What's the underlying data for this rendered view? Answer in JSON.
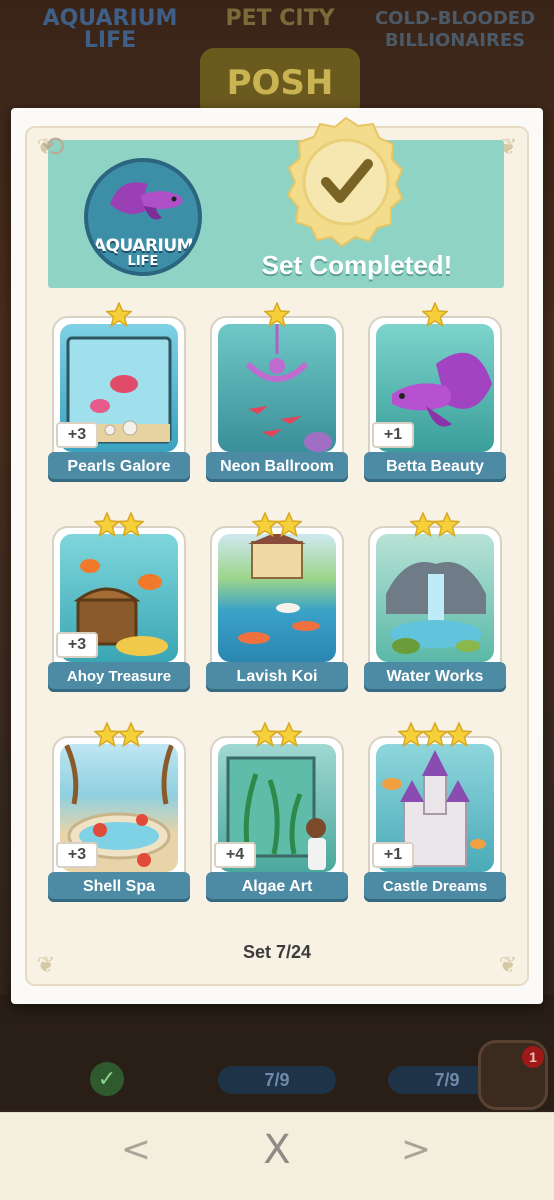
{
  "background": {
    "title": "POSH PETS",
    "sets": [
      {
        "name": "AQUARIUM LIFE",
        "progress": ""
      },
      {
        "name": "PET CITY",
        "progress": "7/9"
      },
      {
        "name": "COLD-BLOODED BILLIONAIRES",
        "progress": "7/9"
      }
    ],
    "notification_count": "1"
  },
  "card": {
    "set_logo": {
      "line1": "AQUARIUM",
      "line2": "LIFE"
    },
    "status_text": "Set Completed!",
    "set_counter": "Set 7/24",
    "stickers": [
      {
        "name": "Pearls Galore",
        "stars": 1,
        "badge": "+3"
      },
      {
        "name": "Neon Ballroom",
        "stars": 1,
        "badge": ""
      },
      {
        "name": "Betta Beauty",
        "stars": 1,
        "badge": "+1"
      },
      {
        "name": "Ahoy Treasure",
        "stars": 2,
        "badge": "+3"
      },
      {
        "name": "Lavish Koi",
        "stars": 2,
        "badge": ""
      },
      {
        "name": "Water Works",
        "stars": 2,
        "badge": ""
      },
      {
        "name": "Shell Spa",
        "stars": 2,
        "badge": "+3"
      },
      {
        "name": "Algae Art",
        "stars": 2,
        "badge": "+4"
      },
      {
        "name": "Castle Dreams",
        "stars": 3,
        "badge": "+1"
      }
    ]
  },
  "nav": {
    "prev": "<",
    "close": "X",
    "next": ">"
  },
  "colors": {
    "banner": "#8fd3c4",
    "label": "#4d8aa3",
    "star": "#f5d03a",
    "seal": "#f3dc8c"
  }
}
